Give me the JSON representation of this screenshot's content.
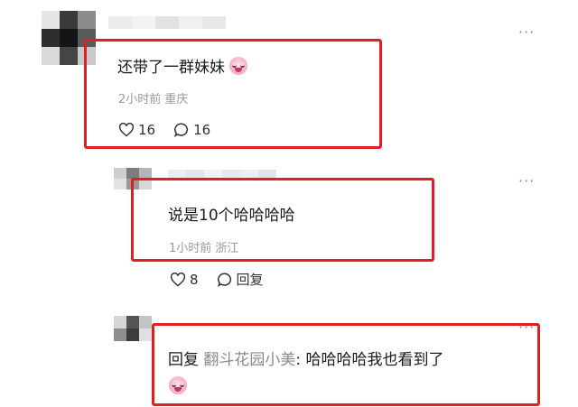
{
  "comments": [
    {
      "text": "还带了一群妹妹",
      "meta": "2小时前 重庆",
      "likes": "16",
      "replies": "16"
    },
    {
      "text": "说是10个哈哈哈哈",
      "meta": "1小时前 浙江",
      "likes": "8",
      "reply_label": "回复"
    },
    {
      "reply_keyword": "回复",
      "mention": "翻斗花园小美",
      "separator": ":",
      "text": "哈哈哈哈我也看到了"
    }
  ],
  "more_label": "···",
  "icons": {
    "like": "heart-icon",
    "comment": "comment-bubble-icon",
    "emoji": "crying-laugh-emoji"
  },
  "colors": {
    "highlight_border": "#e02020",
    "meta_text": "#9a9a9a",
    "mention_text": "#8a8a8a"
  }
}
